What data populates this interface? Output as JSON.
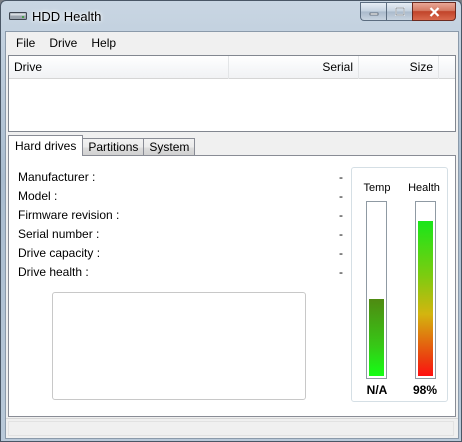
{
  "window": {
    "title": "HDD Health",
    "icon": "hard-drive-icon"
  },
  "menu": [
    "File",
    "Drive",
    "Help"
  ],
  "drive_list": {
    "columns": {
      "drive": "Drive",
      "serial": "Serial",
      "size": "Size"
    },
    "rows": []
  },
  "tabs": [
    "Hard drives",
    "Partitions",
    "System"
  ],
  "active_tab": "Hard drives",
  "info": {
    "manufacturer": {
      "label": "Manufacturer :",
      "value": "-"
    },
    "model": {
      "label": "Model :",
      "value": "-"
    },
    "firmware": {
      "label": "Firmware revision :",
      "value": "-"
    },
    "serial": {
      "label": "Serial number :",
      "value": "-"
    },
    "capacity": {
      "label": "Drive capacity :",
      "value": "-"
    },
    "health": {
      "label": "Drive health :",
      "value": "-"
    }
  },
  "gauges": {
    "temp": {
      "title": "Temp",
      "value_text": "N/A",
      "fill_fraction": 0.45
    },
    "health": {
      "title": "Health",
      "value_text": "98%",
      "fill_fraction": 0.9
    }
  },
  "colors": {
    "close_button": "#c1432a",
    "health_high": "#19e619",
    "health_low": "#ff1010",
    "temp_fill": "#37c716"
  }
}
